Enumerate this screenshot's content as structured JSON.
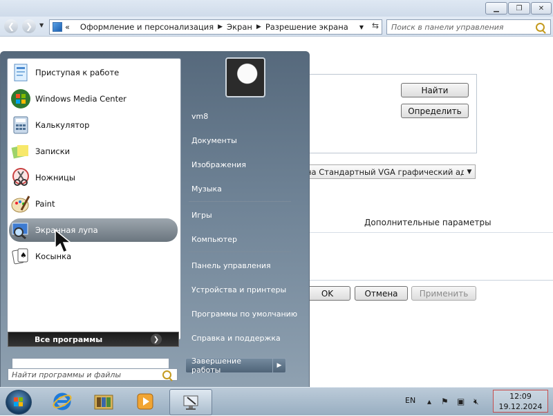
{
  "window": {
    "breadcrumb": [
      "Оформление и персонализация",
      "Экран",
      "Разрешение экрана"
    ],
    "breadcrumb_prefix": "«",
    "search_placeholder": "Поиск в панели управления",
    "buttons": {
      "find": "Найти",
      "detect": "Определить",
      "ok": "OK",
      "cancel": "Отмена",
      "apply": "Применить"
    },
    "monitor_select_value": "на Стандартный VGA графический адапт",
    "advanced_link": "Дополнительные параметры"
  },
  "start_menu": {
    "pinned": [
      {
        "label": "Приступая к работе",
        "icon": "getting-started-icon"
      },
      {
        "label": "Windows Media Center",
        "icon": "media-center-icon"
      },
      {
        "label": "Калькулятор",
        "icon": "calculator-icon"
      },
      {
        "label": "Записки",
        "icon": "sticky-notes-icon"
      },
      {
        "label": "Ножницы",
        "icon": "snipping-tool-icon"
      },
      {
        "label": "Paint",
        "icon": "paint-icon"
      },
      {
        "label": "Экранная лупа",
        "icon": "magnifier-icon"
      },
      {
        "label": "Косынка",
        "icon": "solitaire-icon"
      }
    ],
    "all_programs": "Все программы",
    "search_placeholder": "Найти программы и файлы",
    "right": {
      "user": "vm8",
      "documents": "Документы",
      "pictures": "Изображения",
      "music": "Музыка",
      "games": "Игры",
      "computer": "Компьютер",
      "control_panel": "Панель управления",
      "devices": "Устройства и принтеры",
      "default_programs": "Программы по умолчанию",
      "help": "Справка и поддержка"
    },
    "shutdown": "Завершение работы"
  },
  "taskbar": {
    "language": "EN",
    "time": "12:09",
    "date": "19.12.2024"
  }
}
